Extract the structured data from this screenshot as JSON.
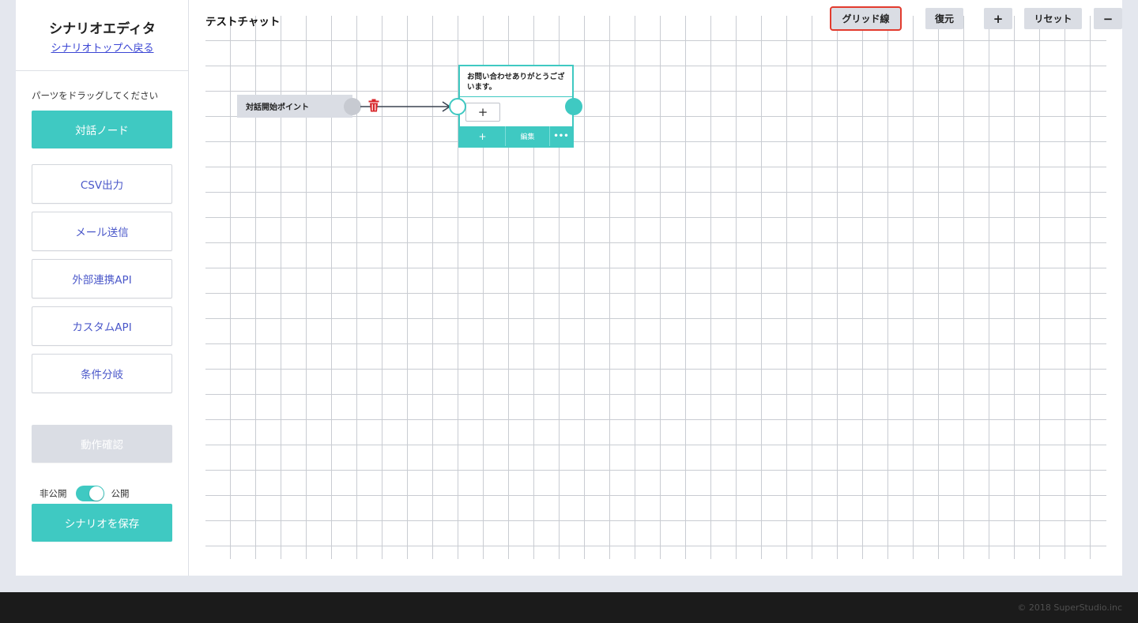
{
  "sidebar": {
    "title": "シナリオエディタ",
    "back_link": "シナリオトップへ戻る",
    "instruction": "パーツをドラッグしてください",
    "parts": {
      "dialog_node": "対話ノード",
      "csv_output": "CSV出力",
      "mail_send": "メール送信",
      "external_api": "外部連携API",
      "custom_api": "カスタムAPI",
      "condition_branch": "条件分岐"
    },
    "test_button": "動作確認",
    "visibility": {
      "private_label": "非公開",
      "public_label": "公開",
      "is_public": true
    },
    "save_button": "シナリオを保存"
  },
  "canvas": {
    "title": "テストチャット",
    "toolbar": {
      "grid_lines": "グリッド線",
      "restore": "復元",
      "zoom_in": "+",
      "reset": "リセット",
      "zoom_out": "−"
    },
    "start_node": {
      "label": "対話開始ポイント"
    },
    "dialog_node": {
      "message": "お問い合わせありがとうございます。",
      "add_choice": "+",
      "footer_add": "+",
      "footer_edit": "編集",
      "footer_more": "•••"
    }
  },
  "colors": {
    "accent": "#3fc9c2",
    "link": "#3b46d4",
    "part_text": "#4a57c9",
    "delete": "#d8262a",
    "highlight_outline": "#e23b2e"
  },
  "icons": {
    "trash": "trash-icon",
    "arrow": "arrow-right-icon"
  },
  "footer": {
    "copyright": "© 2018 SuperStudio.inc"
  }
}
